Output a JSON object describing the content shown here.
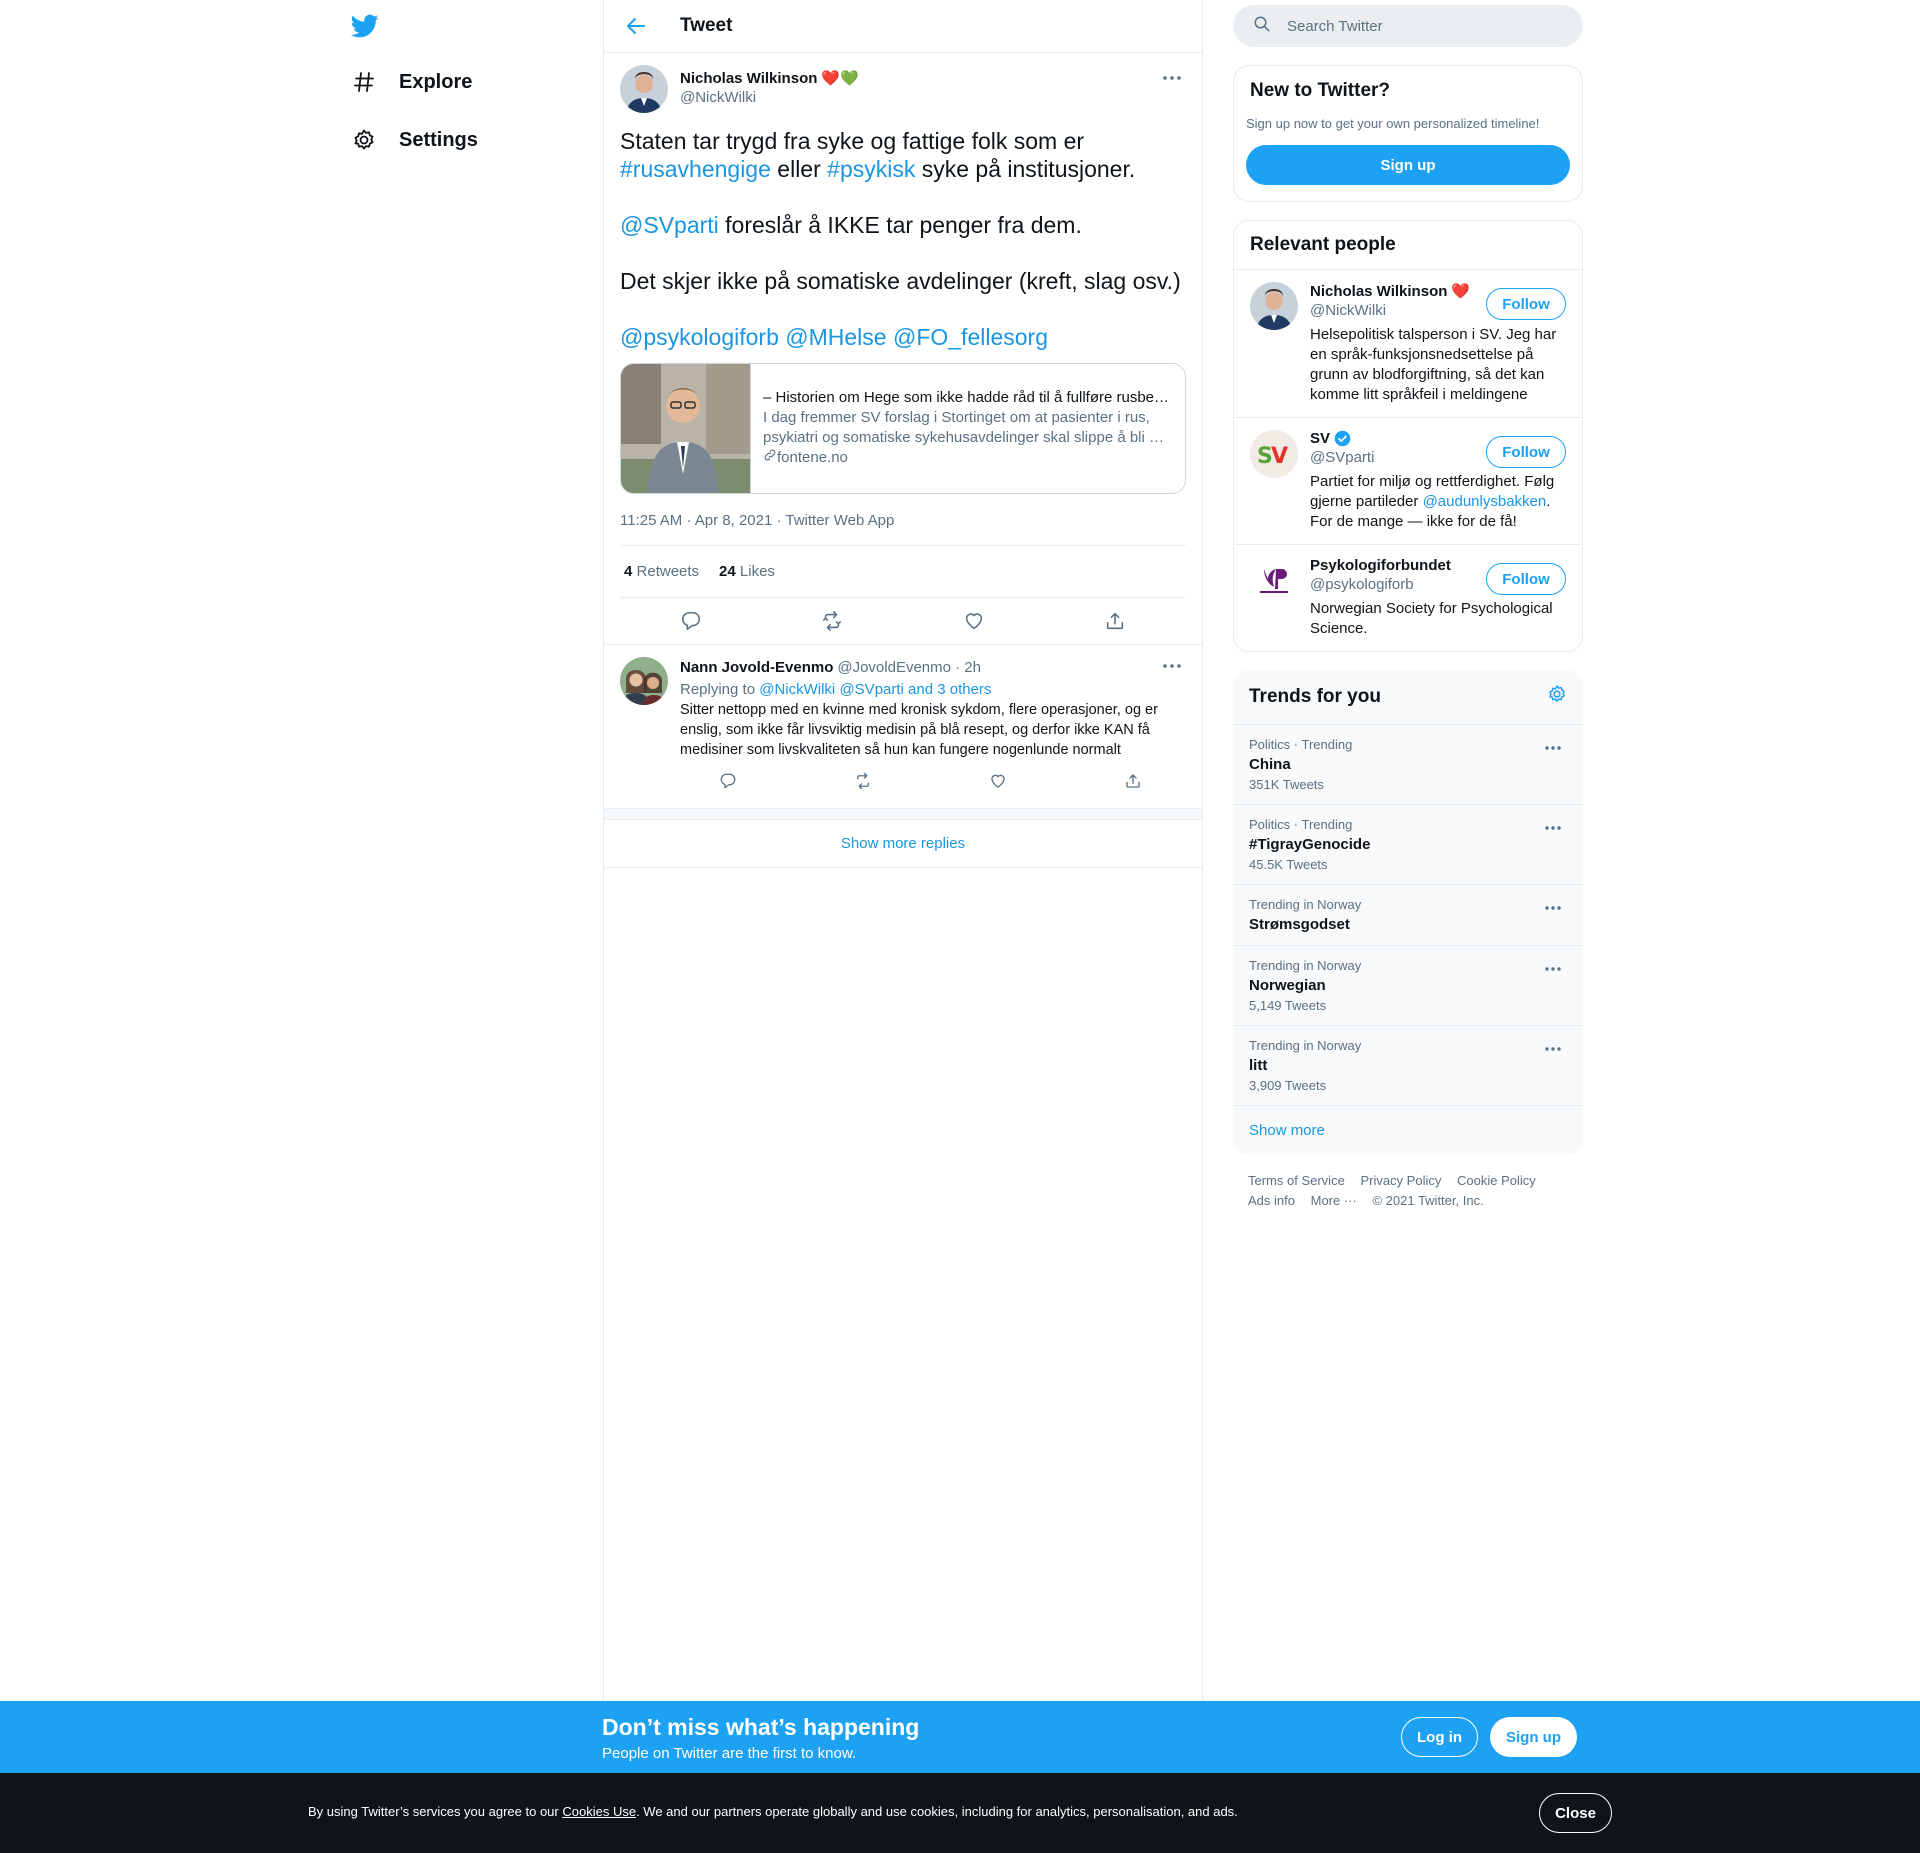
{
  "nav": {
    "items": [
      {
        "label": "Explore",
        "icon": "hashtag-icon"
      },
      {
        "label": "Settings",
        "icon": "gear-icon"
      }
    ]
  },
  "header": {
    "title": "Tweet"
  },
  "tweet": {
    "author_name": "Nicholas Wilkinson",
    "author_emoji": "❤️💚",
    "author_handle": "@NickWilki",
    "text": {
      "p1_a": "Staten tar trygd fra syke og fattige folk som er ",
      "p1_tag1": "#rusavhengige",
      "p1_b": " eller ",
      "p1_tag2": "#psykisk",
      "p1_c": " syke på institusjoner.",
      "p2_mention": "@SVparti",
      "p2_rest": " foreslår å IKKE tar penger fra dem.",
      "p3": "Det skjer ikke på somatiske avdelinger (kreft, slag osv.)",
      "p4_m1": "@psykologiforb",
      "p4_m2": "@MHelse",
      "p4_m3": "@FO_fellesorg"
    },
    "card": {
      "title": "– Historien om Hege som ikke hadde råd til å fullføre rusbe…",
      "description": "I dag fremmer SV forslag i Stortinget om at pasienter i rus, psykiatri og somatiske sykehusavdelinger skal slippe å bli …",
      "domain": "fontene.no"
    },
    "meta": "11:25 AM · Apr 8, 2021 · Twitter Web App",
    "retweets_count": "4",
    "retweets_label": "Retweets",
    "likes_count": "24",
    "likes_label": "Likes"
  },
  "reply": {
    "name": "Nann Jovold-Evenmo",
    "handle": "@JovoldEvenmo · 2h",
    "replying_prefix": "Replying to ",
    "replying_m1": "@NickWilki",
    "replying_m2": "@SVparti and 3 others",
    "text": "Sitter nettopp med en kvinne med kronisk sykdom, flere operasjoner, og er enslig, som ikke får livsviktig medisin på blå resept, og derfor ikke KAN få medisiner som livskvaliteten så hun kan fungere nogenlunde normalt"
  },
  "show_more_replies": "Show more replies",
  "search": {
    "placeholder": "Search Twitter"
  },
  "new_to_twitter": {
    "title": "New to Twitter?",
    "subtitle": "Sign up now to get your own personalized timeline!",
    "button": "Sign up"
  },
  "relevant_people": {
    "title": "Relevant people",
    "follow_label": "Follow",
    "people": [
      {
        "name": "Nicholas Wilkinson",
        "name_suffix": "❤️",
        "handle": "@NickWilki",
        "bio": "Helsepolitisk talsperson i SV. Jeg har en språk-funksjonsnedsettelse på grunn av blodforgiftning, så det kan komme litt språkfeil i meldingene"
      },
      {
        "name": "SV",
        "handle": "@SVparti",
        "bio_a": "Partiet for miljø og rettferdighet. Følg gjerne partileder ",
        "bio_mention": "@audunlysbakken",
        "bio_b": ". For de mange — ikke for de få!"
      },
      {
        "name": "Psykologiforbundet",
        "handle": "@psykologiforb",
        "bio": "Norwegian Society for Psychological Science."
      }
    ]
  },
  "trends": {
    "title": "Trends for you",
    "items": [
      {
        "context": "Politics · Trending",
        "name": "China",
        "count": "351K Tweets"
      },
      {
        "context": "Politics · Trending",
        "name": "#TigrayGenocide",
        "count": "45.5K Tweets"
      },
      {
        "context": "Trending in Norway",
        "name": "Strømsgodset",
        "count": ""
      },
      {
        "context": "Trending in Norway",
        "name": "Norwegian",
        "count": "5,149 Tweets"
      },
      {
        "context": "Trending in Norway",
        "name": "litt",
        "count": "3,909 Tweets"
      }
    ],
    "show_more": "Show more"
  },
  "footer": {
    "terms": "Terms of Service",
    "privacy": "Privacy Policy",
    "cookie": "Cookie Policy",
    "ads": "Ads info",
    "more": "More ···",
    "copyright": "© 2021 Twitter, Inc."
  },
  "promo": {
    "title": "Don’t miss what’s happening",
    "subtitle": "People on Twitter are the first to know.",
    "login": "Log in",
    "signup": "Sign up"
  },
  "cookie_bar": {
    "text_a": "By using Twitter’s services you agree to our ",
    "link": "Cookies Use",
    "text_b": ". We and our partners operate globally and use cookies, including for analytics, personalisation, and ads.",
    "close": "Close"
  },
  "colors": {
    "accent": "#1da1f2",
    "link": "#1b95e0",
    "muted": "#5b7083",
    "cookie_bg": "#0f1419"
  }
}
